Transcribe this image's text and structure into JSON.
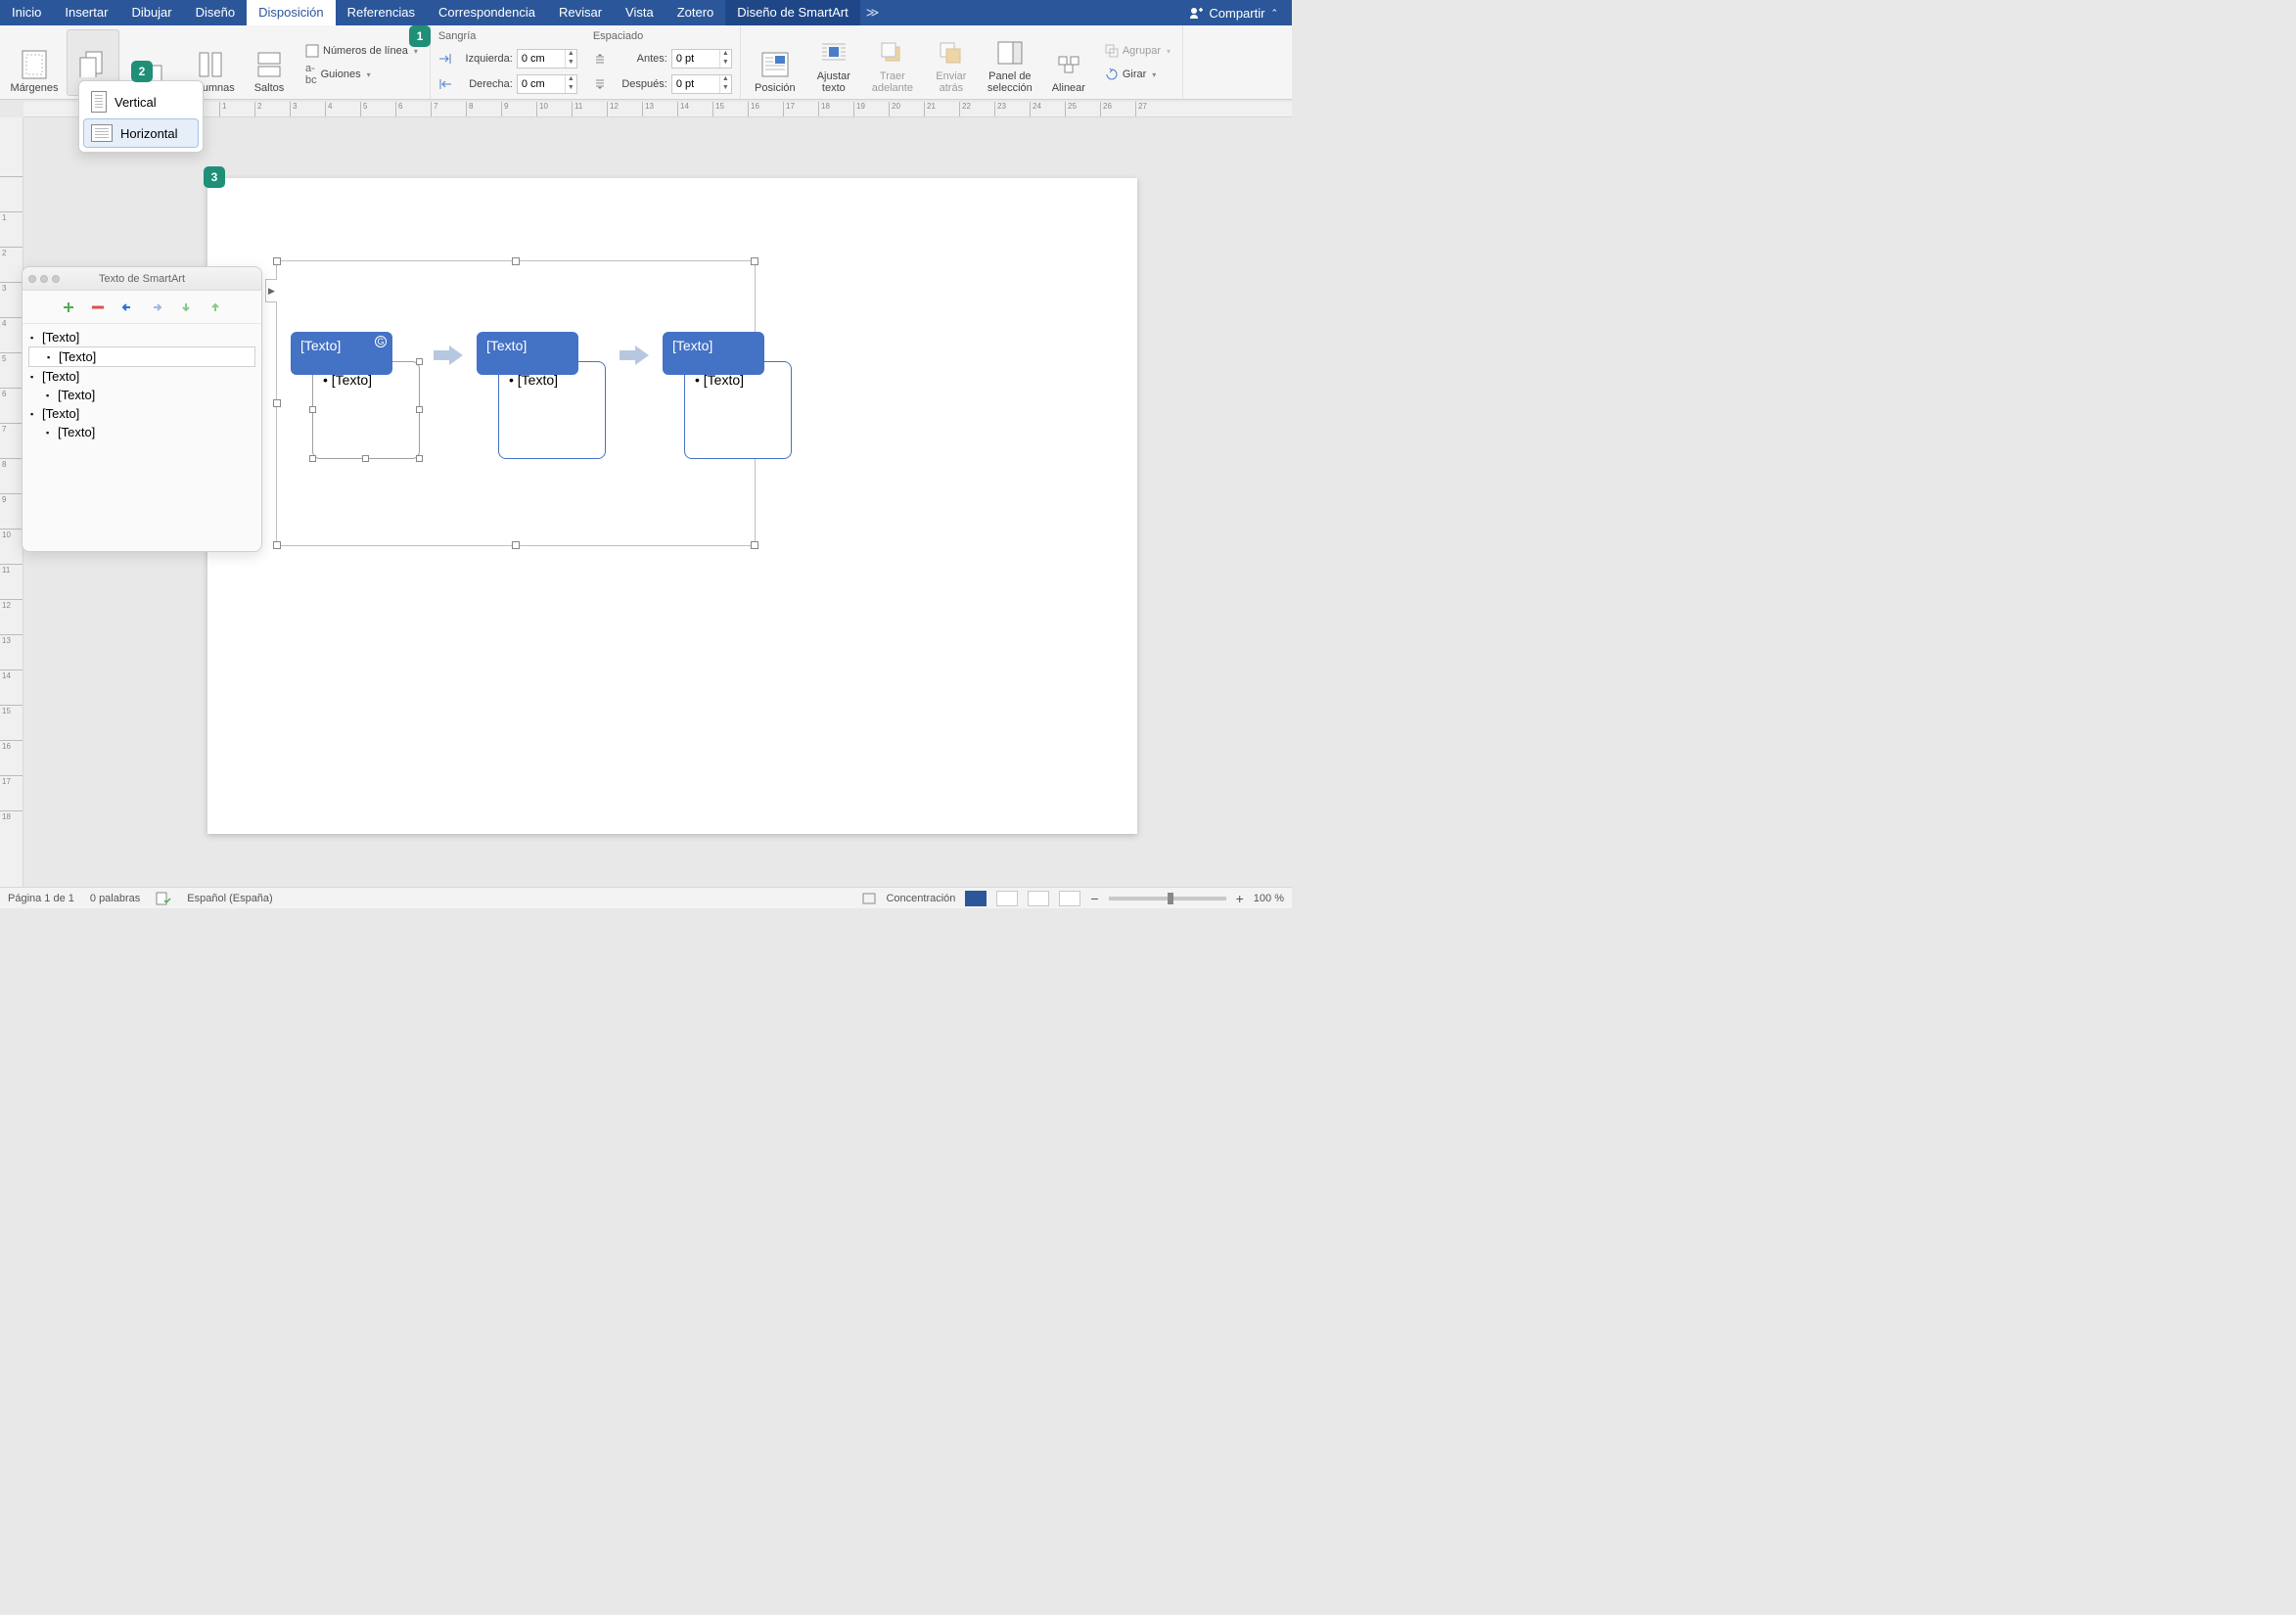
{
  "tabs": {
    "items": [
      "Inicio",
      "Insertar",
      "Dibujar",
      "Diseño",
      "Disposición",
      "Referencias",
      "Correspondencia",
      "Revisar",
      "Vista",
      "Zotero"
    ],
    "active": "Disposición",
    "smartart_tab": "Diseño de SmartArt",
    "share": "Compartir"
  },
  "ribbon": {
    "margenes": "Márgenes",
    "columnas": "Columnas",
    "saltos": "Saltos",
    "numeros": "Números de línea",
    "guiones": "Guiones",
    "sangria_hdr": "Sangría",
    "izq": "Izquierda:",
    "der": "Derecha:",
    "izq_val": "0 cm",
    "der_val": "0 cm",
    "espac_hdr": "Espaciado",
    "antes": "Antes:",
    "despues": "Después:",
    "antes_val": "0 pt",
    "despues_val": "0 pt",
    "posicion": "Posición",
    "ajustar": "Ajustar texto",
    "traer": "Traer adelante",
    "enviar": "Enviar atrás",
    "panel": "Panel de selección",
    "alinear": "Alinear",
    "agrupar": "Agrupar",
    "girar": "Girar"
  },
  "orientation": {
    "vertical": "Vertical",
    "horizontal": "Horizontal"
  },
  "steps": {
    "s1": "1",
    "s2": "2",
    "s3": "3"
  },
  "ruler": {
    "h": [
      "1",
      "2",
      "3",
      "4",
      "5",
      "6",
      "7",
      "8",
      "9",
      "10",
      "11",
      "12",
      "13",
      "14",
      "15",
      "16",
      "17",
      "18",
      "19",
      "20",
      "21",
      "22",
      "23",
      "24",
      "25",
      "26",
      "27"
    ],
    "v": [
      "",
      "1",
      "2",
      "3",
      "4",
      "5",
      "6",
      "7",
      "8",
      "9",
      "10",
      "11",
      "12",
      "13",
      "14",
      "15",
      "16",
      "17",
      "18"
    ]
  },
  "smartart": {
    "placeholder": "[Texto]"
  },
  "textpane": {
    "title": "Texto de SmartArt",
    "items": [
      {
        "lvl": 1,
        "txt": "[Texto]"
      },
      {
        "lvl": 2,
        "txt": "[Texto]",
        "sel": true
      },
      {
        "lvl": 1,
        "txt": "[Texto]"
      },
      {
        "lvl": 2,
        "txt": "[Texto]"
      },
      {
        "lvl": 1,
        "txt": "[Texto]"
      },
      {
        "lvl": 2,
        "txt": "[Texto]"
      }
    ]
  },
  "status": {
    "page": "Página 1 de 1",
    "words": "0 palabras",
    "lang": "Español (España)",
    "focus": "Concentración",
    "zoom": "100 %"
  }
}
